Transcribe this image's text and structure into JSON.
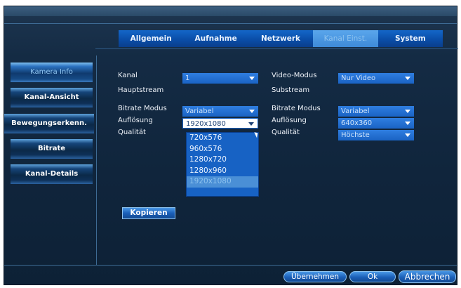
{
  "tabs": {
    "items": [
      {
        "label": "Allgemein"
      },
      {
        "label": "Aufnahme"
      },
      {
        "label": "Netzwerk"
      },
      {
        "label": "Kanal Einst."
      },
      {
        "label": "System"
      }
    ],
    "active": "Kanal Einst."
  },
  "sidebar": {
    "items": [
      {
        "label": "Kamera Info"
      },
      {
        "label": "Kanal-Ansicht"
      },
      {
        "label": "Bewegungserkenn."
      },
      {
        "label": "Bitrate"
      },
      {
        "label": "Kanal-Details"
      }
    ],
    "active": "Kamera Info"
  },
  "form": {
    "kanal_label": "Kanal",
    "kanal_value": "1",
    "video_modus_label": "Video-Modus",
    "video_modus_value": "Nur Video",
    "hauptstream_label": "Hauptstream",
    "substream_label": "Substream",
    "main": {
      "bitrate_modus_label": "Bitrate Modus",
      "bitrate_modus_value": "Variabel",
      "aufloesung_label": "Auflösung",
      "aufloesung_value": "1920x1080",
      "qualitaet_label": "Qualität"
    },
    "sub": {
      "bitrate_modus_label": "Bitrate Modus",
      "bitrate_modus_value": "Variabel",
      "aufloesung_label": "Auflösung",
      "aufloesung_value": "640x360",
      "qualitaet_label": "Qualität",
      "qualitaet_value": "Höchste"
    },
    "resolution_options": [
      "720x576",
      "960x576",
      "1280x720",
      "1280x960",
      "1920x1080"
    ],
    "resolution_selected": "1920x1080"
  },
  "buttons": {
    "copy": "Kopieren",
    "apply": "Übernehmen",
    "ok": "Ok",
    "cancel": "Abbrechen"
  },
  "colors": {
    "background": "#10253c",
    "accent": "#1a63c4",
    "active_text": "#8ec3ef"
  }
}
